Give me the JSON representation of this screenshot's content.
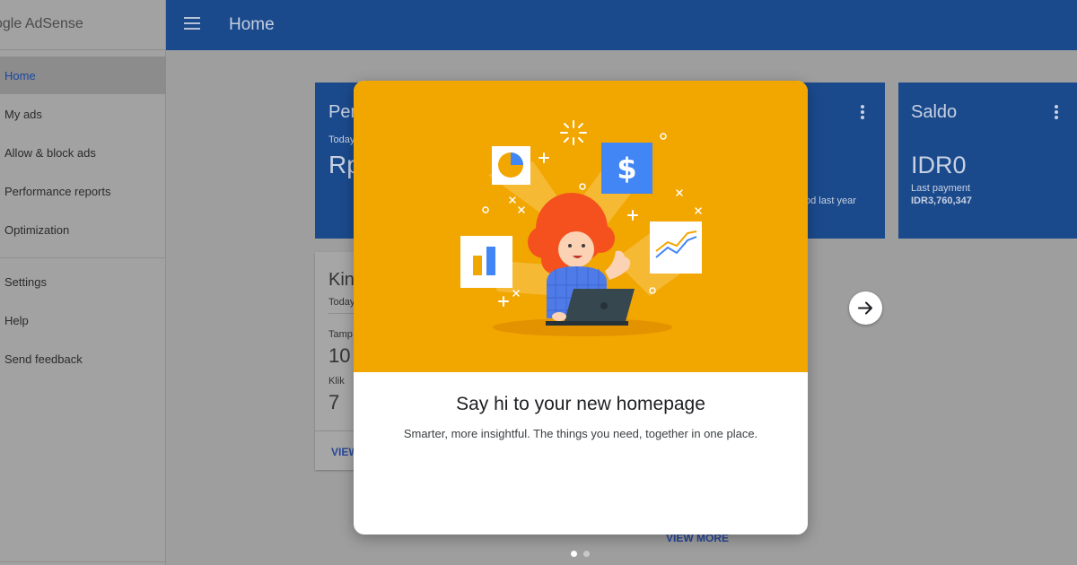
{
  "app": {
    "brand": "ogle AdSense"
  },
  "sidebar": {
    "items": [
      {
        "label": "Home"
      },
      {
        "label": "My ads"
      },
      {
        "label": "Allow & block ads"
      },
      {
        "label": "Performance reports"
      },
      {
        "label": "Optimization"
      },
      {
        "label": "Settings"
      },
      {
        "label": "Help"
      },
      {
        "label": "Send feedback"
      }
    ]
  },
  "header": {
    "title": "Home"
  },
  "cards": {
    "estimated": {
      "title": "Per",
      "period": "Today",
      "value": "Rp"
    },
    "balance": {
      "title": "Saldo",
      "value": "IDR0",
      "last_payment_label": "Last payment",
      "last_payment_value": "IDR3,760,347"
    },
    "middle": {
      "fragment": "od last year"
    },
    "performance": {
      "title": "Kin",
      "period": "Today",
      "impressions_label": "Tamp",
      "impressions_value": "10",
      "clicks_label": "Klik",
      "clicks_value": "7",
      "view_more": "VIEW"
    }
  },
  "modal": {
    "title": "Say hi to your new homepage",
    "subtitle": "Smarter, more insightful. The things you need, together in one place."
  },
  "footer": {
    "view_more": "VIEW MORE"
  },
  "pager": {
    "current": 1,
    "total": 2
  },
  "icons": {
    "menu": "hamburger-menu-icon",
    "more": "more-vert-icon",
    "next": "arrow-right-icon"
  },
  "colors": {
    "header": "#1b4a8c",
    "accent_art": "#f2a600",
    "active_link": "#1a47a0"
  }
}
